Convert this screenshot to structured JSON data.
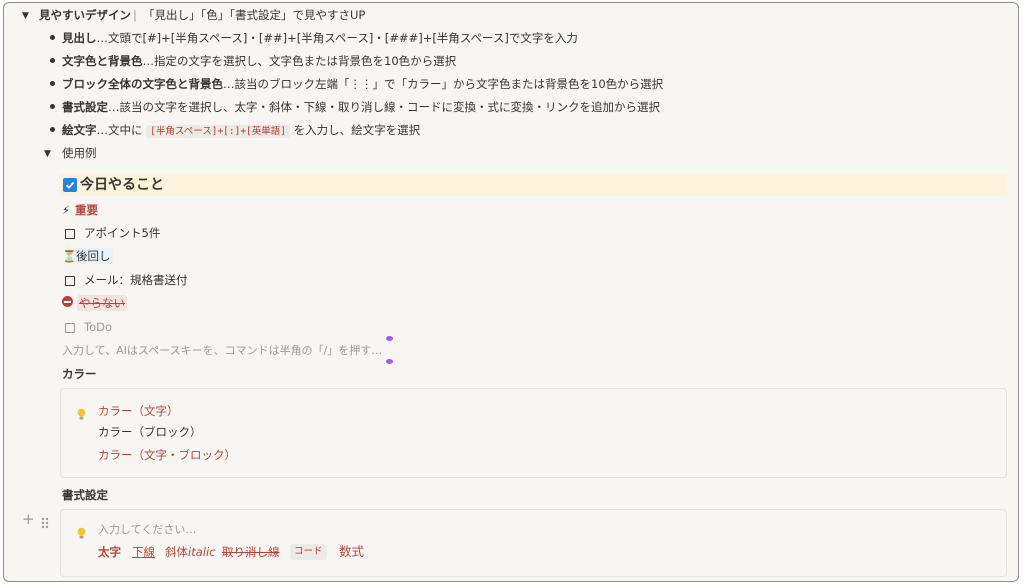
{
  "toggle_main": {
    "title": "見やすいデザイン",
    "separator": "|",
    "subtitle": "「見出し」「色」「書式設定」で見やすさUP"
  },
  "bullets": [
    {
      "label": "見出し",
      "text": "…文頭で[#]+[半角スペース]・[##]+[半角スペース]・[###]+[半角スペース]で文字を入力"
    },
    {
      "label": "文字色と背景色",
      "text": "…指定の文字を選択し、文字色または背景色を10色から選択"
    },
    {
      "label": "ブロック全体の文字色と背景色",
      "text": "…該当のブロック左端「⋮⋮」で「カラー」から文字色または背景色を10色から選択"
    },
    {
      "label": "書式設定",
      "text": "…該当の文字を選択し、太字・斜体・下線・取り消し線・コードに変換・式に変換・リンクを追加から選択"
    },
    {
      "label": "絵文字",
      "text_before": "…文中に",
      "code": "[半角スペース]+[:]+[英単語]",
      "text_after": "を入力し、絵文字を選択"
    }
  ],
  "example_toggle": {
    "label": "使用例"
  },
  "todo_header": {
    "text": "今日やること",
    "checked": true
  },
  "sections": {
    "important": {
      "emoji": "⚡",
      "text": "重要"
    },
    "todo_1": {
      "text": "アポイント5件",
      "checked": false
    },
    "later": {
      "emoji": "⏳",
      "text": "後回し"
    },
    "todo_2": {
      "text": "メール：規格書送付",
      "checked": false
    },
    "dont": {
      "emoji": "⛔",
      "text": "やらない"
    },
    "todo_3": {
      "text": "ToDo",
      "checked": false
    }
  },
  "input_placeholder": "入力して、AIはスペースキーを、コマンドは半角の「/」を押す…",
  "color_heading": "カラー",
  "color_callout": {
    "icon": "lightbulb-icon",
    "lines": [
      "カラー（文字）",
      "カラー（ブロック）",
      "カラー（文字・ブロック）"
    ]
  },
  "format_heading": "書式設定",
  "format_callout": {
    "icon": "lightbulb-icon",
    "placeholder": "入力してください…",
    "bold": "太字",
    "underline": "下線",
    "italic_jp": "斜体",
    "italic_en": "italic",
    "strike": "取り消し線",
    "code": "コード",
    "math": "数式"
  },
  "colors": {
    "red_text": "#b5453b",
    "yellow_bg": "#fbf3db",
    "checkbox_blue": "#2383e2"
  }
}
